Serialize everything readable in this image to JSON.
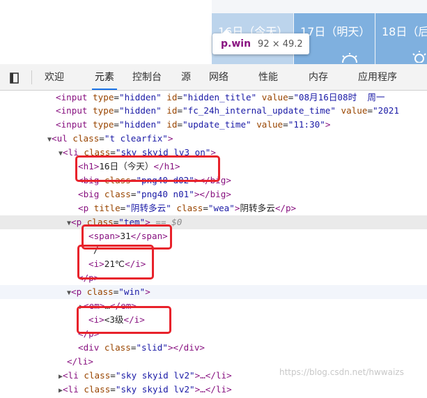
{
  "preview": {
    "tiles": [
      "16日（今天）",
      "17日（明天）",
      "18日（后"
    ],
    "tooltip": {
      "selector": "p.win",
      "dimensions": "92 × 49.2"
    }
  },
  "toolbar": {
    "tabs": [
      "欢迎",
      "元素",
      "控制台",
      "源",
      "网络",
      "性能",
      "内存",
      "应用程序"
    ],
    "active_tab": "元素"
  },
  "tree": {
    "l0": {
      "tag1": "<input ",
      "a1": "type",
      "v1": "\"hidden\"",
      "a2": "id",
      "v2": "\"hidden_title\"",
      "a3": "value",
      "v3": "\"08月16日08时  周一"
    },
    "l1": {
      "tag1": "<input ",
      "a1": "type",
      "v1": "\"hidden\"",
      "a2": "id",
      "v2": "\"fc_24h_internal_update_time\"",
      "a3": "value",
      "v3": "\"2021"
    },
    "l2": {
      "tag1": "<input ",
      "a1": "type",
      "v1": "\"hidden\"",
      "a2": "id",
      "v2": "\"update_time\"",
      "a3": "value",
      "v3": "\"11:30\"",
      "end": ">"
    },
    "l3": {
      "tag": "<ul ",
      "a": "class",
      "v": "\"t clearfix\"",
      "end": ">"
    },
    "l4": {
      "tag": "<li ",
      "a": "class",
      "v": "\"sky skyid lv3 on\"",
      "end": ">"
    },
    "l5": {
      "open": "<h1>",
      "text": "16日（今天）",
      "close": "</h1>"
    },
    "l6": {
      "tag": "<big ",
      "a": "class",
      "v": "\"png40 d02\"",
      "end": "></big>"
    },
    "l7": {
      "tag": "<big ",
      "a": "class",
      "v": "\"png40 n01\"",
      "end": "></big>"
    },
    "l8": {
      "tag": "<p ",
      "a1": "title",
      "v1": "\"阴转多云\"",
      "a2": "class",
      "v2": "\"wea\"",
      "mid": ">",
      "text": "阴转多云",
      "close": "</p>"
    },
    "l9": {
      "tag": "<p ",
      "a": "class",
      "v": "\"tem\"",
      "end": ">",
      "note": "== $0"
    },
    "l10": {
      "open": "<span>",
      "text": "31",
      "close": "</span>"
    },
    "l11": {
      "text": "/"
    },
    "l12": {
      "open": "<i>",
      "text": "21℃",
      "close": "</i>"
    },
    "l13": {
      "close": "</p>"
    },
    "l14": {
      "tag": "<p ",
      "a": "class",
      "v": "\"win\"",
      "end": ">"
    },
    "l15": {
      "open": "<em>",
      "text": "…",
      "close": "</em>"
    },
    "l16": {
      "open": "<i>",
      "text": "<3级",
      "close": "</i>"
    },
    "l17": {
      "close": "</p>"
    },
    "l18": {
      "tag": "<div ",
      "a": "class",
      "v": "\"slid\"",
      "end": "></div>"
    },
    "l19": {
      "close": "</li>"
    },
    "l20": {
      "tag": "<li ",
      "a": "class",
      "v": "\"sky skyid lv2\"",
      "end": ">…</li>"
    },
    "l21": {
      "tag": "<li ",
      "a": "class",
      "v": "\"sky skyid lv2\"",
      "end": ">…</li>"
    }
  },
  "watermark": "https://blog.csdn.net/hwwaizs",
  "colors": {
    "highlight": "#e8222b",
    "tag": "#881280",
    "attr_name": "#994500",
    "attr_value": "#1a1aa6",
    "tab_underline": "#1a73e8"
  }
}
